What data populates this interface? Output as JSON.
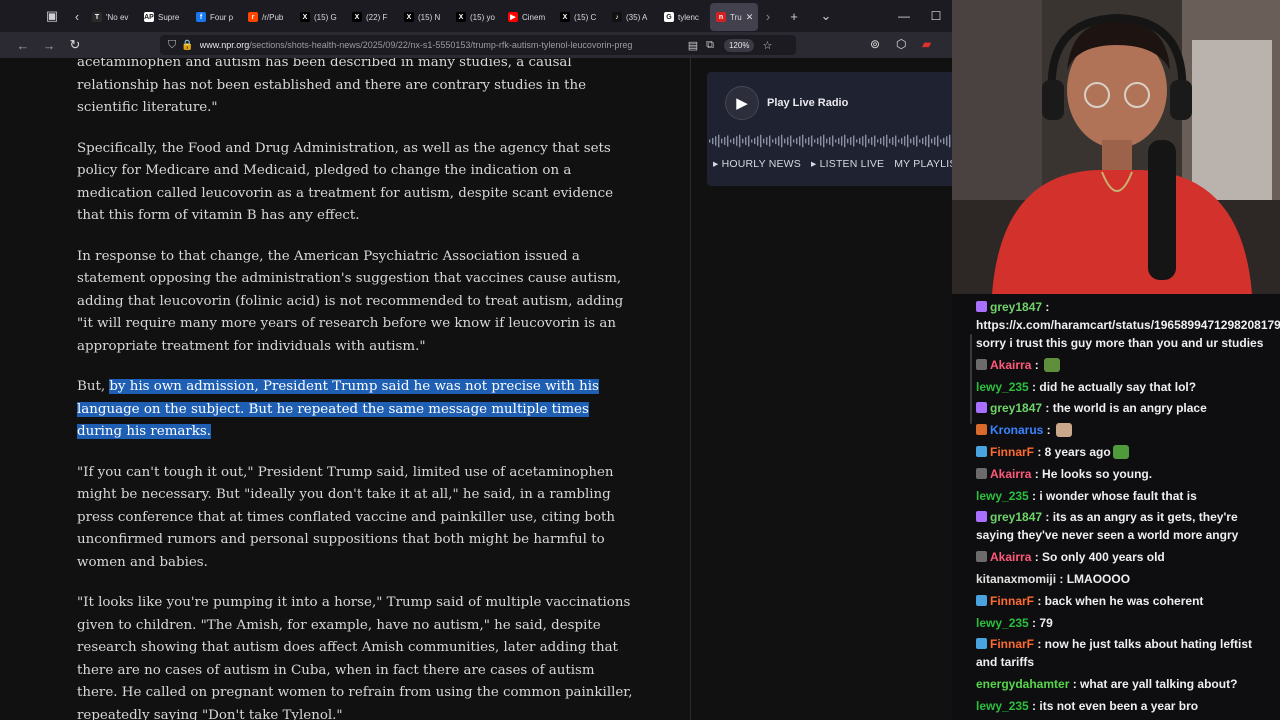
{
  "browser": {
    "tabs": [
      {
        "label": "'No ev",
        "fav": "nyt-icon",
        "color": "#2a2a2a",
        "glyph": "T"
      },
      {
        "label": "Supre",
        "fav": "ap-icon",
        "color": "#ffffff",
        "glyph": "AP"
      },
      {
        "label": "Four p",
        "fav": "facebook-icon",
        "color": "#1877f2",
        "glyph": "f"
      },
      {
        "label": "/r/Pub",
        "fav": "reddit-icon",
        "color": "#ff4500",
        "glyph": "r"
      },
      {
        "label": "(15) G",
        "fav": "x-icon",
        "color": "#000000",
        "glyph": "X"
      },
      {
        "label": "(22) F",
        "fav": "x-icon",
        "color": "#000000",
        "glyph": "X"
      },
      {
        "label": "(15) N",
        "fav": "x-icon",
        "color": "#000000",
        "glyph": "X"
      },
      {
        "label": "(15) yo",
        "fav": "x-icon",
        "color": "#000000",
        "glyph": "X"
      },
      {
        "label": "Cinem",
        "fav": "youtube-icon",
        "color": "#ff0000",
        "glyph": "▶"
      },
      {
        "label": "(15) C",
        "fav": "x-icon",
        "color": "#000000",
        "glyph": "X"
      },
      {
        "label": "(35) A",
        "fav": "tiktok-icon",
        "color": "#111111",
        "glyph": "♪"
      },
      {
        "label": "tylenc",
        "fav": "google-icon",
        "color": "#ffffff",
        "glyph": "G"
      },
      {
        "label": "Tru",
        "fav": "npr-icon",
        "color": "#d62021",
        "glyph": "n",
        "active": true
      }
    ],
    "url_domain": "www.npr.org",
    "url_path": "/sections/shots-health-news/2025/09/22/nx-s1-5550153/trump-rfk-autism-tylenol-leucovorin-preg",
    "zoom": "120%"
  },
  "article": {
    "paragraphs": [
      "acetaminophen and autism has been described in many studies, a causal relationship has not been established and there are contrary studies in the scientific literature.\"",
      "Specifically, the Food and Drug Administration, as well as the agency that sets policy for Medicare and Medicaid, pledged to change the indication on a medication called leucovorin as a treatment for autism, despite scant evidence that this form of vitamin B has any effect.",
      "In response to that change, the American Psychiatric Association issued a statement opposing the administration's suggestion that vaccines cause autism, adding that leucovorin (folinic acid) is not recommended to treat autism, adding \"it will require many more years of research before we know if leucovorin is an appropriate treatment for individuals with autism.\"",
      "\"If you can't tough it out,\" President Trump said, limited use of acetaminophen might be necessary. But \"ideally you don't take it at all,\" he said, in a rambling press conference that at times conflated vaccine and painkiller use, citing both unconfirmed rumors and personal suppositions that both might be harmful to women and babies.",
      "\"It looks like you're pumping it into a horse,\" Trump said of multiple vaccinations given to children. \"The Amish, for example, have no autism,\" he said, despite research showing that autism does affect Amish communities, later adding that there are no cases of autism in Cuba, when in fact there are cases of autism there. He called on pregnant women to refrain from using the common painkiller, repeatedly saying \"Don't take Tylenol.\""
    ],
    "highlight_prefix": "But, ",
    "highlight_text": "by his own admission, President Trump said he was not precise with his language on the subject. But he repeated the same message multiple times during his remarks."
  },
  "radio": {
    "play_label": "Play Live Radio",
    "links": [
      "▸ HOURLY NEWS",
      "▸ LISTEN LIVE",
      "MY PLAYLIST"
    ]
  },
  "chat": {
    "messages": [
      {
        "user": "grey1847",
        "color": "#6fd36a",
        "badge": "#a970ff",
        "text": "https://x.com/haramcart/status/1965899471298208179 sorry i trust this guy more than you and ur studies"
      },
      {
        "user": "Akairra",
        "color": "#ff5a7a",
        "badge": "#6b6b6b",
        "text": "",
        "emote": "#5f8f3a"
      },
      {
        "user": "lewy_235",
        "color": "#2cbf3c",
        "badge": "",
        "text": "did he actually say that lol?"
      },
      {
        "user": "grey1847",
        "color": "#6fd36a",
        "badge": "#a970ff",
        "text": "the world is an angry place"
      },
      {
        "user": "Kronarus",
        "color": "#3a84ff",
        "badge": "#d96a2b",
        "text": "",
        "emote": "#c9a78a"
      },
      {
        "user": "FinnarF",
        "color": "#ff6a2f",
        "badge": "#4aa3df",
        "text": "8 years ago",
        "emote": "#4f9a3a"
      },
      {
        "user": "Akairra",
        "color": "#ff5a7a",
        "badge": "#6b6b6b",
        "text": "He looks so young."
      },
      {
        "user": "lewy_235",
        "color": "#2cbf3c",
        "badge": "",
        "text": "i wonder whose fault that is"
      },
      {
        "user": "grey1847",
        "color": "#6fd36a",
        "badge": "#a970ff",
        "text": "its as an angry as it gets, they're saying they've never seen a world more angry"
      },
      {
        "user": "Akairra",
        "color": "#ff5a7a",
        "badge": "#6b6b6b",
        "text": "So only 400 years old"
      },
      {
        "user": "kitanaxmomiji",
        "color": "#e0e0e0",
        "badge": "",
        "text": "LMAOOOO"
      },
      {
        "user": "FinnarF",
        "color": "#ff6a2f",
        "badge": "#4aa3df",
        "text": "back when he was coherent"
      },
      {
        "user": "lewy_235",
        "color": "#2cbf3c",
        "badge": "",
        "text": "79"
      },
      {
        "user": "FinnarF",
        "color": "#ff6a2f",
        "badge": "#4aa3df",
        "text": "now he just talks about hating leftist and tariffs"
      },
      {
        "user": "energydahamter",
        "color": "#57d64b",
        "badge": "",
        "text": "what are yall talking about?"
      },
      {
        "user": "lewy_235",
        "color": "#2cbf3c",
        "badge": "",
        "text": "its not even been a year bro"
      }
    ]
  }
}
